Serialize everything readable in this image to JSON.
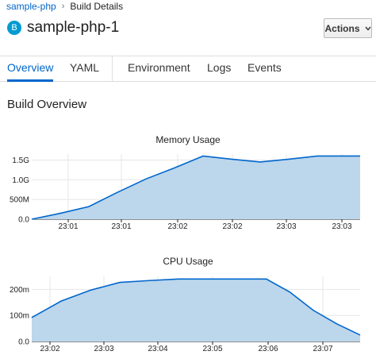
{
  "breadcrumb": {
    "parent": "sample-php",
    "separator": "›",
    "current": "Build Details"
  },
  "header": {
    "badge": "B",
    "title": "sample-php-1",
    "actions_label": "Actions",
    "actions_icon": "chevron-down-icon"
  },
  "tabs": [
    {
      "label": "Overview",
      "active": true
    },
    {
      "label": "YAML",
      "active": false
    },
    {
      "label": "Environment",
      "active": false
    },
    {
      "label": "Logs",
      "active": false
    },
    {
      "label": "Events",
      "active": false
    }
  ],
  "section_title": "Build Overview",
  "colors": {
    "accent": "#0066cc",
    "chart_line": "#0066cc",
    "chart_fill": "#bcd6ec",
    "badge": "#009bd2"
  },
  "chart_data": [
    {
      "type": "area",
      "title": "Memory Usage",
      "x_ticks": [
        "23:01",
        "23:01",
        "23:02",
        "23:02",
        "23:03",
        "23:03"
      ],
      "y_ticks": [
        "0.0",
        "500M",
        "1.0G",
        "1.5G"
      ],
      "y_tick_values": [
        0,
        0.5,
        1.0,
        1.5
      ],
      "ylim": [
        0,
        1.65
      ],
      "unit": "G",
      "x": [
        0,
        0.2,
        0.4,
        0.6,
        0.8,
        1.0,
        1.2,
        1.4,
        1.6,
        1.8,
        2.0,
        2.2,
        2.3
      ],
      "values": [
        0.0,
        0.15,
        0.32,
        0.68,
        1.02,
        1.3,
        1.6,
        1.52,
        1.45,
        1.52,
        1.6,
        1.6,
        1.6
      ],
      "grid": true
    },
    {
      "type": "area",
      "title": "CPU Usage",
      "x_ticks": [
        "23:02",
        "23:03",
        "23:04",
        "23:05",
        "23:06",
        "23:07"
      ],
      "y_ticks": [
        "0.0",
        "100m",
        "200m"
      ],
      "y_tick_values": [
        0,
        100,
        200
      ],
      "ylim": [
        0,
        250
      ],
      "unit": "m",
      "x": [
        0,
        0.5,
        1.0,
        1.5,
        2.0,
        2.5,
        3.0,
        3.5,
        4.0,
        4.4,
        4.8,
        5.2,
        5.6
      ],
      "values": [
        92,
        155,
        197,
        227,
        234,
        240,
        240,
        240,
        240,
        190,
        120,
        68,
        25
      ],
      "grid": true
    }
  ]
}
